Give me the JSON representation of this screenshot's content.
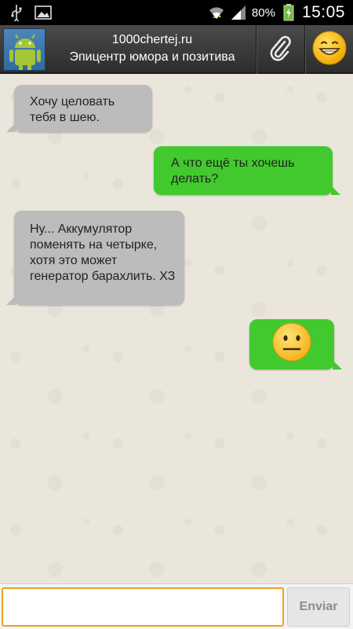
{
  "status_bar": {
    "icons": [
      "usb-icon",
      "gallery-icon",
      "wifi-icon",
      "signal-icon",
      "battery-icon"
    ],
    "battery_percent": "80%",
    "time": "15:05"
  },
  "header": {
    "title": "1000chertej.ru",
    "subtitle": "Эпицентр юмора и позитива",
    "avatar_icon": "android-icon",
    "attach_icon": "paperclip-icon",
    "emoji_icon": "smile-emoji-icon"
  },
  "messages": [
    {
      "direction": "incoming",
      "text": "Хочу целовать тебя в шею."
    },
    {
      "direction": "outgoing",
      "text": "А что ещё ты хочешь делать?"
    },
    {
      "direction": "incoming",
      "text": "Ну... Аккумулятор поменять на четырке, хотя это может генератор барахлить. ХЗ"
    },
    {
      "direction": "outgoing",
      "emoji": "neutral-face-emoji-icon"
    }
  ],
  "composer": {
    "input_value": "",
    "send_label": "Enviar"
  },
  "colors": {
    "incoming_bubble": "#bcbcbc",
    "outgoing_bubble": "#42c92e",
    "input_focus_border": "#f0a020"
  }
}
